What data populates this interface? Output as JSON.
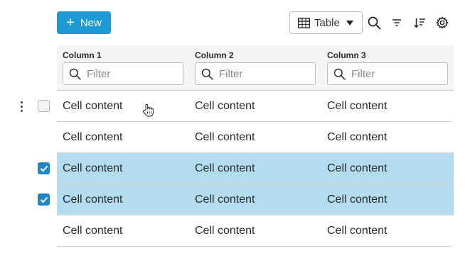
{
  "toolbar": {
    "new_label": "New",
    "view_label": "Table"
  },
  "columns": [
    {
      "title": "Column 1",
      "filter_placeholder": "Filter"
    },
    {
      "title": "Column 2",
      "filter_placeholder": "Filter"
    },
    {
      "title": "Column 3",
      "filter_placeholder": "Filter"
    }
  ],
  "rows": [
    {
      "cells": [
        "Cell content",
        "Cell content",
        "Cell content"
      ],
      "selected": false,
      "checkbox_shown": true,
      "menu_shown": true
    },
    {
      "cells": [
        "Cell content",
        "Cell content",
        "Cell content"
      ],
      "selected": false,
      "checkbox_shown": false,
      "menu_shown": false
    },
    {
      "cells": [
        "Cell content",
        "Cell content",
        "Cell content"
      ],
      "selected": true,
      "checkbox_shown": true,
      "menu_shown": false
    },
    {
      "cells": [
        "Cell content",
        "Cell content",
        "Cell content"
      ],
      "selected": true,
      "checkbox_shown": true,
      "menu_shown": false
    },
    {
      "cells": [
        "Cell content",
        "Cell content",
        "Cell content"
      ],
      "selected": false,
      "checkbox_shown": false,
      "menu_shown": false
    }
  ],
  "colors": {
    "accent": "#1e9ad6",
    "selected_row": "#b3dcef",
    "checkbox_checked": "#1c87c9"
  },
  "icons": [
    "plus-icon",
    "table-icon",
    "chevron-down-icon",
    "search-icon",
    "filter-icon",
    "sort-icon",
    "gear-icon",
    "more-vertical-icon",
    "hand-cursor-icon"
  ]
}
